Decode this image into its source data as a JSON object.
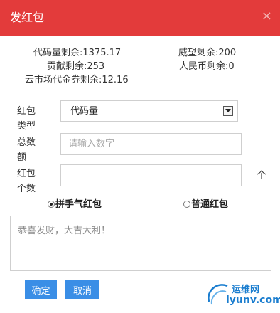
{
  "dialog": {
    "title": "发红包",
    "close_glyph": "×"
  },
  "stats": {
    "code_amount": "代码量剩余:1375.17",
    "prestige": "威望剩余:200",
    "contribution": "贡献剩余:253",
    "rmb": "人民币剩余:0",
    "voucher": "云市场代金券剩余:12.16"
  },
  "form": {
    "type_label": "红包类型",
    "type_label_l1": "红包",
    "type_label_l2": "类型",
    "type_value": "代码量",
    "total_label": "总数额",
    "total_label_l1": "总数",
    "total_label_l2": "额",
    "total_placeholder": "请输入数字",
    "count_label": "红包个数",
    "count_label_l1": "红包",
    "count_label_l2": "个数",
    "count_value": "",
    "count_unit": "个",
    "mode_lucky": "拼手气红包",
    "mode_normal": "普通红包",
    "mode_selected": "拼手气红包",
    "message_placeholder": "恭喜发财，大吉大利！"
  },
  "actions": {
    "confirm": "确定",
    "cancel": "取消"
  },
  "watermark": {
    "line1": "运维网",
    "line2": "iyunv.com"
  },
  "colors": {
    "header_bg": "#e33b3b",
    "button_bg": "#3a8ee6",
    "watermark": "#1a7dcf"
  }
}
